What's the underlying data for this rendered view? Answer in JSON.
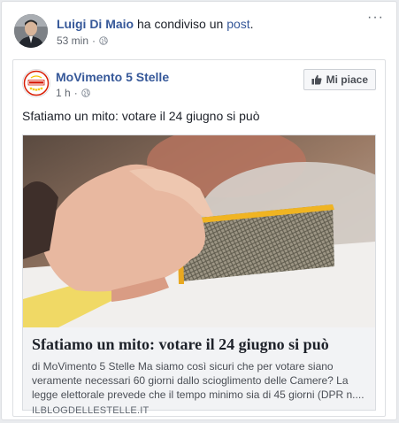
{
  "outer": {
    "author": "Luigi Di Maio",
    "action_text": " ha condiviso un ",
    "post_link": "post",
    "post_link_suffix": ".",
    "time": "53 min",
    "more_label": "···"
  },
  "inner": {
    "page_name": "MoVimento 5 Stelle",
    "time": "1 h",
    "like_button": "Mi piace",
    "post_text": "Sfatiamo un mito: votare il 24 giugno si può"
  },
  "link": {
    "title": "Sfatiamo un mito: votare il 24 giugno si può",
    "description": "di MoVimento 5 Stelle Ma siamo così sicuri che per votare siano veramente necessari 60 giorni dallo scioglimento delle Camere? La legge elettorale prevede che il tempo minimo sia di 45 giorni (DPR n....",
    "domain": "ILBLOGDELLESTELLE.IT"
  },
  "colors": {
    "link_blue": "#365899",
    "muted_text": "#616770",
    "m5s_yellow": "#f5c400",
    "m5s_red": "#d81e05"
  },
  "icons": {
    "privacy": "globe-icon",
    "like": "thumbs-up-icon",
    "more": "more-options-icon"
  }
}
